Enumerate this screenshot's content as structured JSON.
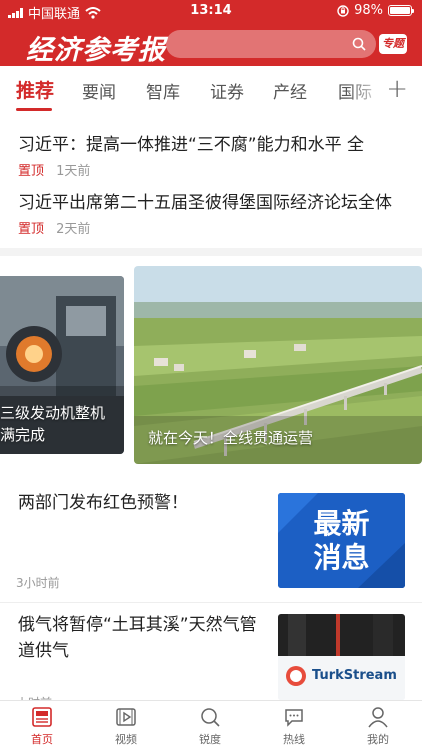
{
  "status_bar": {
    "carrier": "中国联通",
    "time": "13:14",
    "battery": "98%",
    "battery_level": 0.98
  },
  "header": {
    "logo": "经济参考报",
    "special_label": "专题",
    "icons": [
      "search-icon"
    ]
  },
  "tabs": [
    {
      "label": "推荐",
      "active": true
    },
    {
      "label": "要闻"
    },
    {
      "label": "智库"
    },
    {
      "label": "证券"
    },
    {
      "label": "产经"
    },
    {
      "label": "国际"
    }
  ],
  "pinned_news": [
    {
      "title": "习近平：提高一体推进“三不腐”能力和水平 全",
      "badge": "置顶",
      "time": "1天前"
    },
    {
      "title": "习近平出席第二十五届圣彼得堡国际经济论坛全体",
      "badge": "置顶",
      "time": "2天前"
    }
  ],
  "carousel": [
    {
      "caption_line1": "三级发动机整机",
      "caption_line2": "满完成"
    },
    {
      "caption": "就在今天！全线贯通运营"
    }
  ],
  "news_list": [
    {
      "title": "两部门发布红色预警！",
      "time": "3小时前",
      "thumb_line1": "最新",
      "thumb_line2": "消息"
    },
    {
      "title": "俄气将暂停“土耳其溪”天然气管道供气",
      "time": "小时前",
      "thumb_text": "TurkStream"
    }
  ],
  "bottom_nav": [
    {
      "label": "首页",
      "icon": "news-icon",
      "active": true
    },
    {
      "label": "视频",
      "icon": "video-icon"
    },
    {
      "label": "锐度",
      "icon": "search-icon"
    },
    {
      "label": "热线",
      "icon": "chat-icon"
    },
    {
      "label": "我的",
      "icon": "person-icon"
    }
  ],
  "colors": {
    "brand": "#d32a2a"
  }
}
